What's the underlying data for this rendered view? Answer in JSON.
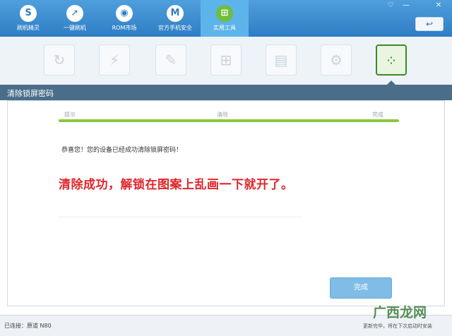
{
  "nav": {
    "tabs": [
      {
        "label": "刷机精灵",
        "icon": "S"
      },
      {
        "label": "一键刷机",
        "icon": "➚"
      },
      {
        "label": "ROM市场",
        "icon": "◉"
      },
      {
        "label": "官方手机安全",
        "icon": "M"
      },
      {
        "label": "实用工具",
        "icon": "⊞"
      }
    ],
    "window_controls": {
      "feedback": "♡",
      "minimize": "—",
      "close": "✕"
    },
    "back_label": "↩"
  },
  "tools": [
    {
      "icon": "refresh-icon",
      "glyph": "↻"
    },
    {
      "icon": "flash-icon",
      "glyph": "⚡"
    },
    {
      "icon": "edit-icon",
      "glyph": "✎"
    },
    {
      "icon": "gift-icon",
      "glyph": "⊞"
    },
    {
      "icon": "android-icon",
      "glyph": "▤"
    },
    {
      "icon": "gears-icon",
      "glyph": "⚙"
    },
    {
      "icon": "pattern-lock-icon",
      "glyph": "⁘"
    }
  ],
  "section": {
    "title": "清除锁屏密码"
  },
  "steps": [
    "提示",
    "清除",
    "完成"
  ],
  "progress": 1.0,
  "message": "恭喜您！您的设备已经成功清除锁屏密码！",
  "note": "清除成功，解锁在图案上乱画一下就开了。",
  "done_label": "完成",
  "status": {
    "connected": "已连接：原道 N80",
    "update": "更新完毕，将在下次启动时安装"
  },
  "watermark": "广西龙网",
  "colors": {
    "accent": "#2e7dc4",
    "success": "#8cc63f",
    "note": "#e1262b"
  }
}
